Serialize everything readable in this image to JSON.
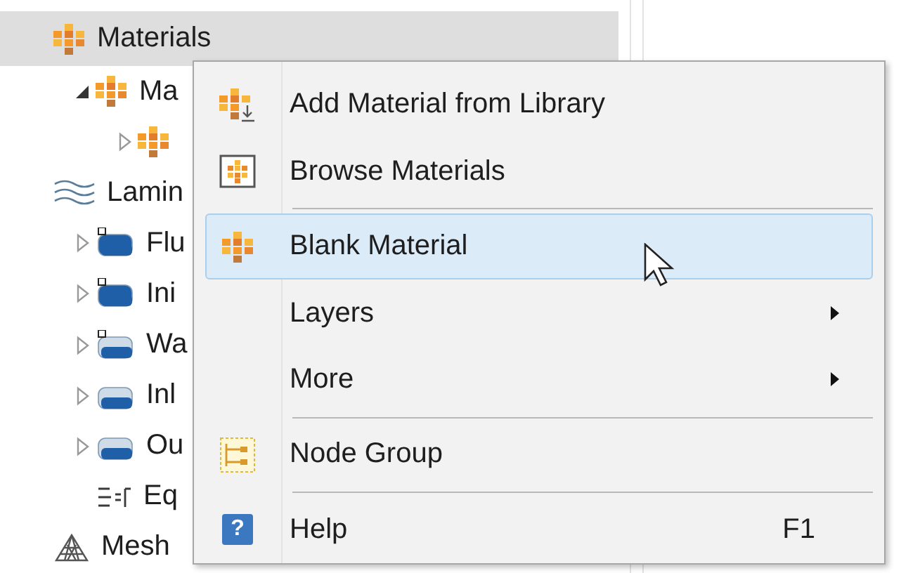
{
  "tree": [
    {
      "label": "Materials",
      "kind": "materials",
      "selected": true,
      "children": [
        {
          "label": "Ma",
          "kind": "materials",
          "selected": false,
          "expanded": true,
          "children": [
            {
              "kind": "materials",
              "selected": false,
              "expanded": false
            }
          ]
        }
      ]
    },
    {
      "label": "Lamin",
      "kind": "waves",
      "selected": false,
      "children": [
        {
          "label": "Flu",
          "kind": "domain-marked",
          "selected": false,
          "expanded": false
        },
        {
          "label": "Ini",
          "kind": "domain-marked",
          "selected": false,
          "expanded": false
        },
        {
          "label": "Wa",
          "kind": "boundary-marked",
          "selected": false,
          "expanded": false
        },
        {
          "label": "Inl",
          "kind": "boundary",
          "selected": false,
          "expanded": false
        },
        {
          "label": "Ou",
          "kind": "boundary",
          "selected": false,
          "expanded": false
        },
        {
          "label": "Eq",
          "kind": "equation",
          "selected": false
        }
      ]
    },
    {
      "label": "Mesh",
      "kind": "mesh",
      "selected": false
    }
  ],
  "context_menu": [
    {
      "kind": "add-material",
      "label": "Add Material from Library",
      "selected": false
    },
    {
      "kind": "browse",
      "label": "Browse Materials",
      "selected": false
    },
    {
      "kind": "separator"
    },
    {
      "kind": "materials",
      "label": "Blank Material",
      "selected": true
    },
    {
      "kind": "plain",
      "label": "Layers",
      "submenu": true,
      "selected": false
    },
    {
      "kind": "plain",
      "label": "More",
      "submenu": true,
      "selected": false
    },
    {
      "kind": "separator"
    },
    {
      "kind": "node-group",
      "label": "Node Group",
      "selected": false
    },
    {
      "kind": "separator"
    },
    {
      "kind": "help",
      "label": "Help",
      "icon_text": "?",
      "shortcut": "F1",
      "selected": false
    }
  ]
}
